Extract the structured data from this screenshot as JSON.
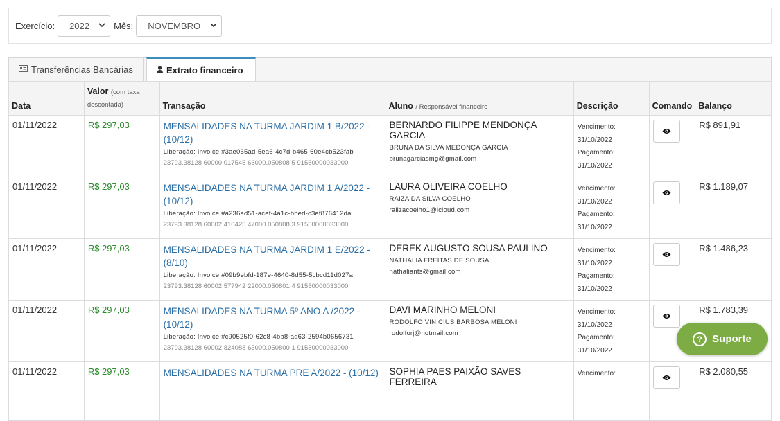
{
  "filters": {
    "exercicio_label": "Exercício:",
    "exercicio_value": "2022",
    "mes_label": "Mês:",
    "mes_value": "NOVEMBRO"
  },
  "tabs": [
    {
      "label": "Transferências Bancárias",
      "icon": "card-icon"
    },
    {
      "label": "Extrato financeiro",
      "icon": "user-icon",
      "active": true
    }
  ],
  "columns": {
    "data": "Data",
    "valor": "Valor",
    "valor_note": "(com taxa descontada)",
    "transacao": "Transação",
    "aluno": "Aluno",
    "aluno_note": "/ Responsável financeiro",
    "descricao": "Descrição",
    "comando": "Comando",
    "balanco": "Balanço"
  },
  "rows": [
    {
      "data": "01/11/2022",
      "valor": "R$ 297,03",
      "transacao": "MENSALIDADES NA TURMA JARDIM 1 B/2022 - (10/12)",
      "liberacao": "Liberação: Invoice #3ae065ad-5ea6-4c7d-b465-60e4cb523fab",
      "codigo": "23793.38128 60000.017545 66000.050808 5 91550000033000",
      "aluno": "BERNARDO FILIPPE MENDONÇA GARCIA",
      "responsavel": "BRUNA DA SILVA MEDONÇA GARCIA",
      "email": "brunagarciasmg@gmail.com",
      "venc_label": "Vencimento:",
      "venc": "31/10/2022",
      "pag_label": "Pagamento:",
      "pag": "31/10/2022",
      "balanco": "R$ 891,91"
    },
    {
      "data": "01/11/2022",
      "valor": "R$ 297,03",
      "transacao": "MENSALIDADES NA TURMA JARDIM 1 A/2022 - (10/12)",
      "liberacao": "Liberação: Invoice #a236ad51-acef-4a1c-bbed-c3ef876412da",
      "codigo": "23793.38128 60002.410425 47000.050808 3 91550000033000",
      "aluno": "LAURA OLIVEIRA COELHO",
      "responsavel": "RAIZA DA SILVA COELHO",
      "email": "raiizacoelho1@icloud.com",
      "venc_label": "Vencimento:",
      "venc": "31/10/2022",
      "pag_label": "Pagamento:",
      "pag": "31/10/2022",
      "balanco": "R$ 1.189,07"
    },
    {
      "data": "01/11/2022",
      "valor": "R$ 297,03",
      "transacao": "MENSALIDADES NA TURMA JARDIM 1 E/2022 - (8/10)",
      "liberacao": "Liberação: Invoice #09b9ebfd-187e-4640-8d55-5cbcd11d027a",
      "codigo": "23793.38128 60002.577942 22000.050801 4 91550000033000",
      "aluno": "DEREK AUGUSTO SOUSA PAULINO",
      "responsavel": "NATHALIA FREITAS DE SOUSA",
      "email": "nathaliants@gmail.com",
      "venc_label": "Vencimento:",
      "venc": "31/10/2022",
      "pag_label": "Pagamento:",
      "pag": "31/10/2022",
      "balanco": "R$ 1.486,23"
    },
    {
      "data": "01/11/2022",
      "valor": "R$ 297,03",
      "transacao": "MENSALIDADES NA TURMA 5º ANO A /2022 - (10/12)",
      "liberacao": "Liberação: Invoice #c90525f0-62c8-4bb8-ad63-2594b0656731",
      "codigo": "23793.38128 60002.824088 65000.050800 1 91550000033000",
      "aluno": "DAVI MARINHO MELONI",
      "responsavel": "RODOLFO VINICIUS BARBOSA MELONI",
      "email": "rodolforj@hotmail.com",
      "venc_label": "Vencimento:",
      "venc": "31/10/2022",
      "pag_label": "Pagamento:",
      "pag": "31/10/2022",
      "balanco": "R$ 1.783,39"
    },
    {
      "data": "01/11/2022",
      "valor": "R$ 297,03",
      "transacao": "MENSALIDADES NA TURMA PRE A/2022 - (10/12)",
      "aluno": "SOPHIA PAES PAIXÃO SAVES FERREIRA",
      "venc_label": "Vencimento:",
      "balanco": "R$ 2.080,55"
    }
  ],
  "support": {
    "label": "Suporte"
  },
  "colors": {
    "valor": "#2e8b2e",
    "link": "#2a6ea6",
    "support_bg": "#7cac43",
    "tab_accent": "#3c8dbc"
  }
}
